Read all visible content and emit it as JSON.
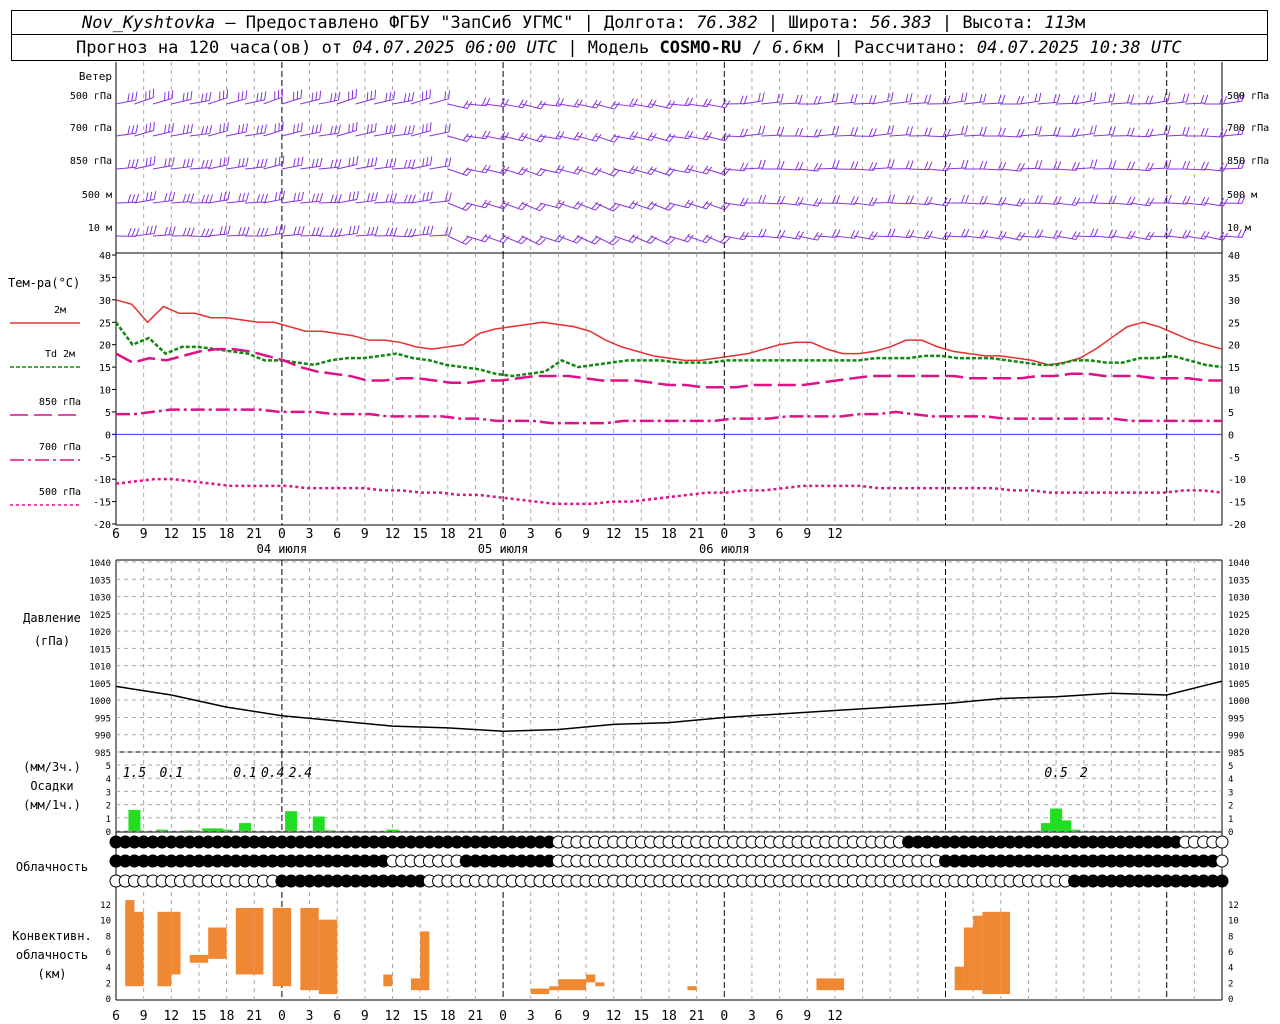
{
  "header": {
    "station": "Nov_Kyshtovka",
    "provider": "— Предоставлено ФГБУ \"ЗапСиб УГМС\"",
    "lon_label": "Долгота:",
    "lon": "76.382",
    "lat_label": "Широта:",
    "lat": "56.383",
    "alt_label": "Высота:",
    "alt": "113",
    "alt_unit": "м",
    "forecast_prefix": "Прогноз на 120 часа(ов) от",
    "run_time": "04.07.2025 06:00 UTC",
    "model_label": "Модель",
    "model": "COSMO-RU",
    "resolution": "6.6",
    "res_unit": "км",
    "calc_label": "Рассчитано:",
    "calc_time": "04.07.2025 10:38 UTC"
  },
  "panels": {
    "wind": {
      "title": "Ветер",
      "levels": [
        "500 гПа",
        "700 гПа",
        "850 гПа",
        "500 м",
        "10 м"
      ],
      "color": "#8833dd"
    },
    "temperature": {
      "title": "Тем-ра(°C)",
      "legend": [
        "2м",
        "Td 2м",
        "850 гПа",
        "700 гПа",
        "500 гПа"
      ],
      "ticks": [
        40,
        35,
        30,
        25,
        20,
        15,
        10,
        5,
        0,
        -5,
        -10,
        -15,
        -20
      ]
    },
    "pressure": {
      "title": "Давление",
      "unit": "(гПа)",
      "ticks": [
        1040,
        1035,
        1030,
        1025,
        1020,
        1015,
        1010,
        1005,
        1000,
        995,
        990,
        985
      ]
    },
    "precip": {
      "unit_top": "(мм/3ч.)",
      "title": "Осадки",
      "unit_bottom": "(мм/1ч.)",
      "ticks": [
        5,
        4,
        3,
        2,
        1,
        0
      ]
    },
    "cloud": {
      "title": "Облачность"
    },
    "convective": {
      "title": [
        "Конвективн.",
        "облачность",
        "(км)"
      ],
      "ticks": [
        12,
        10,
        8,
        6,
        4,
        2,
        0
      ]
    }
  },
  "time_axis": {
    "hour_labels": [
      "6",
      "9",
      "12",
      "15",
      "18",
      "21",
      "0",
      "3",
      "6",
      "9",
      "12",
      "15",
      "18",
      "21",
      "0",
      "3",
      "6",
      "9",
      "12",
      "15",
      "18",
      "21",
      "0",
      "3",
      "6",
      "9",
      "12"
    ],
    "day_labels": [
      "04 июля",
      "05 июля",
      "06 июля"
    ]
  },
  "chart_data": [
    {
      "type": "line",
      "title": "Тем-ра(°C)",
      "x": [
        6,
        8,
        10,
        12,
        14,
        16,
        18,
        20,
        22,
        24,
        26,
        28,
        30,
        32,
        34,
        36,
        38,
        40,
        42,
        44,
        46,
        48,
        50,
        52,
        54,
        56,
        58,
        60,
        62,
        64,
        66,
        68,
        70,
        72,
        74,
        76,
        78,
        80,
        82,
        84,
        86,
        88,
        90,
        92,
        94,
        96,
        98,
        100,
        102,
        104,
        106,
        108,
        110,
        112,
        114,
        116,
        118,
        120,
        122,
        124,
        126
      ],
      "ylim": [
        -20,
        40
      ],
      "series": [
        {
          "name": "2м",
          "color": "#e53030",
          "values": [
            30,
            29,
            25,
            28.5,
            27,
            27,
            26,
            26,
            25.5,
            25,
            25,
            24,
            23,
            23,
            22.5,
            22,
            21,
            21,
            20.5,
            19.5,
            19,
            19.5,
            20,
            22.5,
            23.5,
            24,
            24.5,
            25,
            24.5,
            24,
            23,
            21,
            19.5,
            18.5,
            17.5,
            17,
            16.5,
            16.5,
            17,
            17.5,
            18,
            19,
            20,
            20.5,
            20.5,
            19,
            18,
            18,
            18.5,
            19.5,
            21,
            21,
            19.5,
            18.5,
            18,
            17.5,
            17.5,
            17,
            16.5,
            15.5,
            16,
            17,
            19,
            21.5,
            24,
            25,
            24,
            22.5,
            21,
            20,
            19
          ]
        },
        {
          "name": "Td 2м",
          "color": "#118811",
          "values": [
            25,
            20,
            21.5,
            18,
            19.5,
            19.5,
            19,
            18.5,
            18,
            16.5,
            16.5,
            16,
            15.5,
            16.5,
            17,
            17,
            17.5,
            18,
            17,
            16.5,
            15.5,
            15,
            14.5,
            13.5,
            13,
            13.5,
            14,
            16.5,
            15,
            15.5,
            16,
            16.5,
            16.5,
            16.5,
            16,
            16,
            16,
            16.5,
            16.5,
            16.5,
            16.5,
            16.5,
            16.5,
            16.5,
            16.5,
            16.5,
            17,
            17,
            17,
            17.5,
            17.5,
            17,
            17,
            17,
            16.5,
            16,
            15.5,
            15.5,
            16.5,
            16.5,
            16,
            16,
            17,
            17,
            17.5,
            16.5,
            15.5,
            15
          ]
        },
        {
          "name": "850 гПа",
          "color": "#dd1188",
          "values": [
            18,
            16,
            17,
            16.5,
            17.5,
            18.5,
            19,
            19,
            18.5,
            17.5,
            16.5,
            15,
            14,
            13.5,
            13,
            12,
            12,
            12.5,
            12.5,
            12,
            11.5,
            11.5,
            12,
            12,
            12.5,
            13,
            13,
            13,
            12.5,
            12,
            12,
            12,
            11.5,
            11,
            11,
            10.5,
            10.5,
            10.5,
            11,
            11,
            11,
            11,
            11.5,
            12,
            12.5,
            13,
            13,
            13,
            13,
            13,
            13,
            12.5,
            12.5,
            12.5,
            12.5,
            13,
            13,
            13.5,
            13.5,
            13,
            13,
            13,
            12.5,
            12.5,
            12.5,
            12,
            12
          ]
        },
        {
          "name": "700 гПа",
          "color": "#dd1188",
          "values": [
            4.5,
            4.5,
            5,
            5.5,
            5.5,
            5.5,
            5.5,
            5.5,
            5.5,
            5,
            5,
            5,
            4.5,
            4.5,
            4.5,
            4,
            4,
            4,
            4,
            3.5,
            3.5,
            3,
            3,
            3,
            2.5,
            2.5,
            2.5,
            2.5,
            3,
            3,
            3,
            3,
            3,
            3,
            3.5,
            3.5,
            3.5,
            4,
            4,
            4,
            4,
            4.5,
            4.5,
            5,
            4.5,
            4,
            4,
            4,
            4,
            3.5,
            3.5,
            3.5,
            3.5,
            3.5,
            3.5,
            3.5,
            3,
            3,
            3,
            3,
            3,
            3
          ]
        },
        {
          "name": "500 гПа",
          "color": "#dd1188",
          "values": [
            -11,
            -10.5,
            -10,
            -10,
            -10.5,
            -11,
            -11.5,
            -11.5,
            -11.5,
            -11.5,
            -12,
            -12,
            -12,
            -12,
            -12.5,
            -12.5,
            -13,
            -13,
            -13.5,
            -13.5,
            -14,
            -14.5,
            -15,
            -15.5,
            -15.5,
            -15.5,
            -15,
            -15,
            -14.5,
            -14,
            -13.5,
            -13,
            -13,
            -12.5,
            -12.5,
            -12,
            -11.5,
            -11.5,
            -11.5,
            -11.5,
            -12,
            -12,
            -12,
            -12,
            -12,
            -12,
            -12,
            -12.5,
            -12.5,
            -13,
            -13,
            -13,
            -13,
            -13,
            -13,
            -13,
            -12.5,
            -12.5,
            -13
          ]
        }
      ]
    },
    {
      "type": "line",
      "title": "Давление",
      "ylim": [
        985,
        1040
      ],
      "x": [
        6,
        12,
        18,
        24,
        30,
        36,
        42,
        48,
        54,
        60,
        66,
        72,
        78,
        84,
        90,
        96,
        102,
        108,
        114,
        120,
        126
      ],
      "series": [
        {
          "name": "",
          "color": "#000000",
          "values": [
            1004,
            1001.5,
            998,
            995.5,
            994,
            992.5,
            992,
            991,
            991.5,
            993,
            993.5,
            995,
            996,
            997,
            998,
            999,
            1000.5,
            1001,
            1002,
            1001.5,
            1005.5
          ]
        }
      ]
    },
    {
      "type": "bar",
      "title": "Осадки",
      "ylim": [
        0,
        5
      ],
      "x": [
        8,
        11,
        14,
        16,
        17,
        18,
        20,
        25,
        28,
        29,
        36,
        107,
        108,
        109,
        110
      ],
      "values": [
        1.6,
        0.1,
        0.05,
        0.2,
        0.2,
        0.1,
        0.6,
        1.5,
        1.1,
        0.05,
        0.1,
        0.6,
        1.7,
        0.8,
        0.1
      ],
      "labels": [
        {
          "x": 8,
          "text": "1.5"
        },
        {
          "x": 12,
          "text": "0.1"
        },
        {
          "x": 20,
          "text": "0.1"
        },
        {
          "x": 23,
          "text": "0.4"
        },
        {
          "x": 26,
          "text": "2.4"
        },
        {
          "x": 108,
          "text": "0.5"
        },
        {
          "x": 111,
          "text": "2"
        }
      ]
    },
    {
      "type": "bar",
      "title": "Конвективн. облачность",
      "ylim": [
        0,
        13
      ],
      "segments": [
        [
          6,
          7,
          4.5,
          4.5
        ],
        [
          7,
          8,
          1.5,
          12.5
        ],
        [
          8,
          9,
          1.5,
          11
        ],
        [
          9,
          10.5,
          1,
          1
        ],
        [
          10.5,
          12,
          1.5,
          11
        ],
        [
          12,
          13,
          3,
          11
        ],
        [
          13,
          14,
          4,
          4
        ],
        [
          14,
          16,
          4.5,
          5.5
        ],
        [
          16,
          18,
          5,
          9
        ],
        [
          18,
          19,
          3.5,
          3.5
        ],
        [
          19,
          20,
          3,
          11.5
        ],
        [
          20,
          21,
          3,
          11.5
        ],
        [
          21,
          22,
          3,
          11.5
        ],
        [
          22,
          23,
          4,
          4
        ],
        [
          23,
          25,
          1.5,
          11.5
        ],
        [
          25,
          26,
          1,
          1
        ],
        [
          26,
          28,
          1,
          11.5
        ],
        [
          28,
          30,
          0.5,
          10
        ],
        [
          30,
          31,
          0.5,
          0.5
        ],
        [
          32,
          33,
          1,
          1
        ],
        [
          33,
          34,
          1.5,
          1.5
        ],
        [
          35,
          36,
          1.5,
          3
        ],
        [
          37,
          38,
          2,
          2
        ],
        [
          38,
          39,
          1,
          2.5
        ],
        [
          39,
          40,
          1,
          8.5
        ],
        [
          50,
          51,
          0.5,
          0.5
        ],
        [
          51,
          53,
          0.5,
          1.2
        ],
        [
          53,
          54,
          1,
          1.5
        ],
        [
          54,
          57,
          1,
          2.4
        ],
        [
          57,
          58,
          2,
          3
        ],
        [
          58,
          59,
          1.5,
          2
        ],
        [
          59,
          60,
          0.5,
          0.5
        ],
        [
          60,
          62,
          0.5,
          0.5
        ],
        [
          62,
          63,
          0.5,
          0.5
        ],
        [
          63,
          64,
          0.5,
          0.5
        ],
        [
          68,
          69,
          1,
          1.5
        ],
        [
          82,
          85,
          1,
          2.5
        ],
        [
          96,
          97,
          1.5,
          1.5
        ],
        [
          97,
          98,
          1,
          4
        ],
        [
          98,
          99,
          1,
          9
        ],
        [
          99,
          100,
          1,
          10.5
        ],
        [
          100,
          102,
          0.5,
          11
        ],
        [
          102,
          103,
          0.5,
          11
        ],
        [
          103,
          104,
          1,
          1
        ],
        [
          104,
          106,
          1,
          1
        ]
      ]
    }
  ]
}
